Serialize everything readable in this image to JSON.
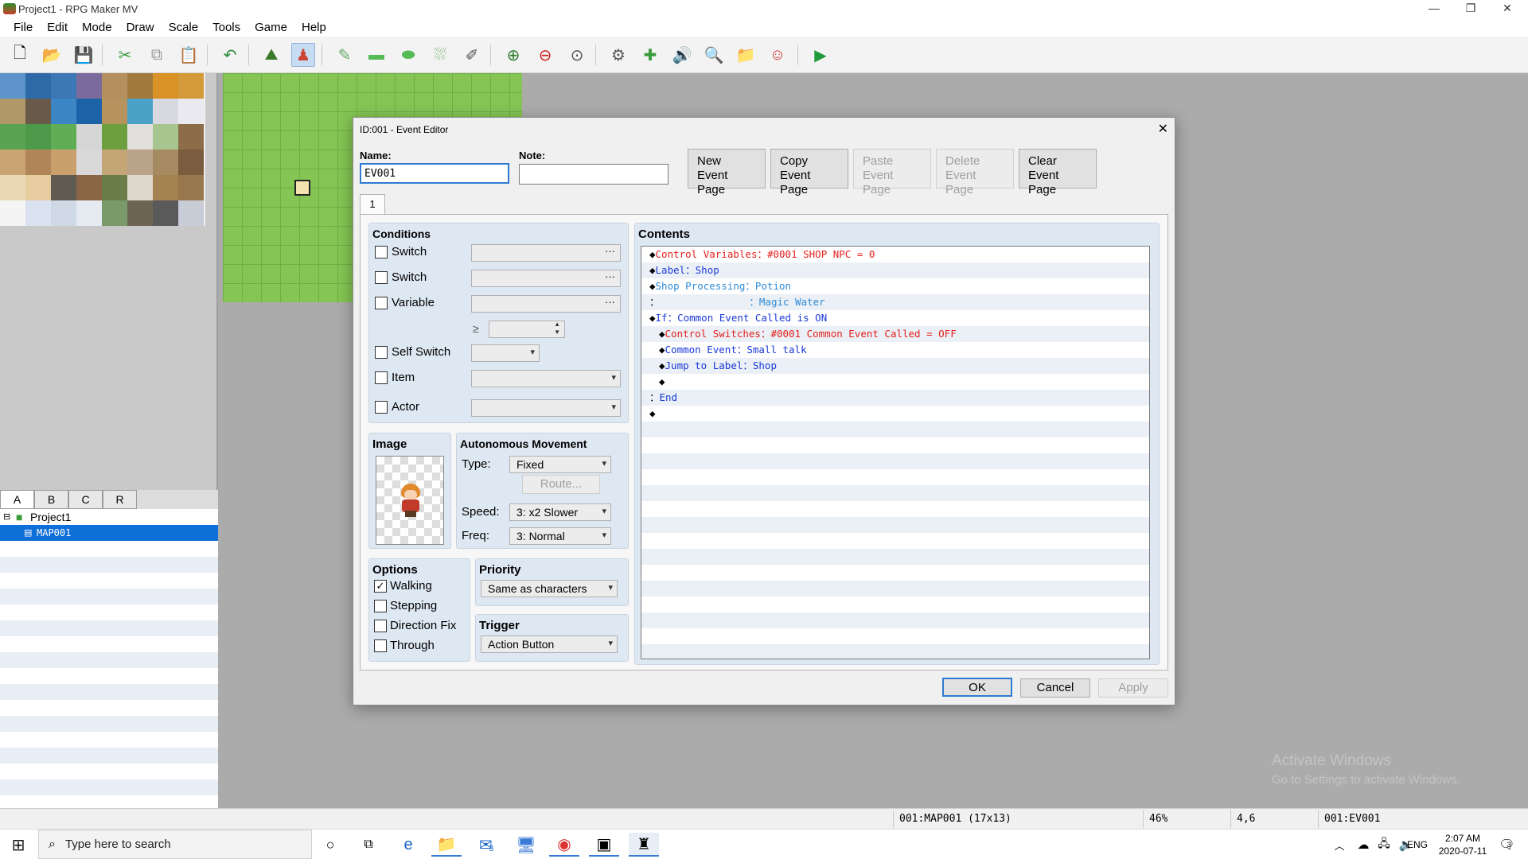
{
  "window": {
    "title": "Project1 - RPG Maker MV"
  },
  "menu": [
    "File",
    "Edit",
    "Mode",
    "Draw",
    "Scale",
    "Tools",
    "Game",
    "Help"
  ],
  "toolbar_icons": [
    "new-project-icon",
    "open-project-icon",
    "save-project-icon",
    "cut-icon",
    "copy-icon",
    "paste-icon",
    "undo-icon",
    "map-mode-icon",
    "event-mode-icon",
    "pencil-icon",
    "rectangle-icon",
    "ellipse-icon",
    "fill-icon",
    "shadow-pen-icon",
    "zoom-in-icon",
    "zoom-out-icon",
    "actual-size-icon",
    "database-icon",
    "plugin-manager-icon",
    "sound-test-icon",
    "event-searcher-icon",
    "resource-manager-icon",
    "character-generator-icon",
    "playtest-icon"
  ],
  "tileset_tabs": [
    "A",
    "B",
    "C",
    "R"
  ],
  "map_tree": {
    "project": "Project1",
    "map": "MAP001"
  },
  "status": {
    "map": "001:MAP001 (17x13)",
    "zoom": "46%",
    "coords": "4,6",
    "event": "001:EV001"
  },
  "watermark": {
    "title": "Activate Windows",
    "subtitle": "Go to Settings to activate Windows."
  },
  "taskbar": {
    "search_placeholder": "Type here to search",
    "mail_badge": "3",
    "lang": "ENG",
    "time": "2:07 AM",
    "date": "2020-07-11",
    "notif_count": "3"
  },
  "dialog": {
    "title": "ID:001 - Event Editor",
    "name_label": "Name:",
    "name_value": "EV001",
    "note_label": "Note:",
    "note_value": "",
    "page_buttons": [
      {
        "line1": "New",
        "line2": "Event Page",
        "enabled": true
      },
      {
        "line1": "Copy",
        "line2": "Event Page",
        "enabled": true
      },
      {
        "line1": "Paste",
        "line2": "Event Page",
        "enabled": false
      },
      {
        "line1": "Delete",
        "line2": "Event Page",
        "enabled": false
      },
      {
        "line1": "Clear",
        "line2": "Event Page",
        "enabled": true
      }
    ],
    "page_tab": "1",
    "conditions": {
      "title": "Conditions",
      "switch1": "Switch",
      "switch2": "Switch",
      "variable": "Variable",
      "gte": "≥",
      "self_switch": "Self Switch",
      "item": "Item",
      "actor": "Actor"
    },
    "image": {
      "title": "Image"
    },
    "movement": {
      "title": "Autonomous Movement",
      "type_label": "Type:",
      "type_value": "Fixed",
      "route": "Route...",
      "speed_label": "Speed:",
      "speed_value": "3: x2 Slower",
      "freq_label": "Freq:",
      "freq_value": "3: Normal"
    },
    "options": {
      "title": "Options",
      "walking": "Walking",
      "stepping": "Stepping",
      "direction_fix": "Direction Fix",
      "through": "Through"
    },
    "priority": {
      "title": "Priority",
      "value": "Same as characters"
    },
    "trigger": {
      "title": "Trigger",
      "value": "Action Button"
    },
    "contents": {
      "title": "Contents",
      "lines": [
        {
          "prefix": "◆",
          "text": "Control Variables：#0001 SHOP NPC = 0",
          "color": "red",
          "indent": 0
        },
        {
          "prefix": "◆",
          "text": "Label：Shop",
          "color": "blue",
          "indent": 0
        },
        {
          "prefix": "◆",
          "text": "Shop Processing：Potion",
          "color": "cyan",
          "indent": 0
        },
        {
          "prefix": "：",
          "text": "               ：Magic Water",
          "color": "cyan",
          "indent": 0
        },
        {
          "prefix": "◆",
          "text": "If：Common Event Called is ON",
          "color": "blue",
          "indent": 0
        },
        {
          "prefix": "◆",
          "text": "Control Switches：#0001 Common Event Called = OFF",
          "color": "red",
          "indent": 1
        },
        {
          "prefix": "◆",
          "text": "Common Event：Small talk",
          "color": "blue",
          "indent": 1
        },
        {
          "prefix": "◆",
          "text": "Jump to Label：Shop",
          "color": "blue",
          "indent": 1
        },
        {
          "prefix": "◆",
          "text": "",
          "color": "black",
          "indent": 1
        },
        {
          "prefix": "：",
          "text": "End",
          "color": "blue",
          "indent": 0
        },
        {
          "prefix": "◆",
          "text": "",
          "color": "black",
          "indent": 0
        }
      ]
    },
    "ok": "OK",
    "cancel": "Cancel",
    "apply": "Apply"
  }
}
